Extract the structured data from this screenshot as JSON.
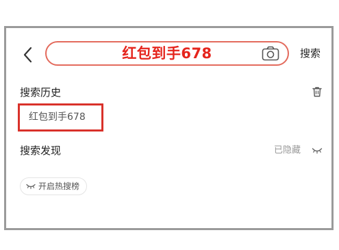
{
  "header": {
    "back_icon": "chevron-left-icon",
    "search_query": "红包到手678",
    "camera_icon": "camera-icon",
    "search_button_label": "搜索",
    "accent_color": "#e5251d"
  },
  "history": {
    "title": "搜索历史",
    "delete_icon": "trash-icon",
    "items": [
      {
        "label": "红包到手678"
      }
    ]
  },
  "discover": {
    "title": "搜索发现",
    "status": "已隐藏",
    "toggle_icon": "eye-closed-icon",
    "enable_label": "开启热搜榜"
  }
}
